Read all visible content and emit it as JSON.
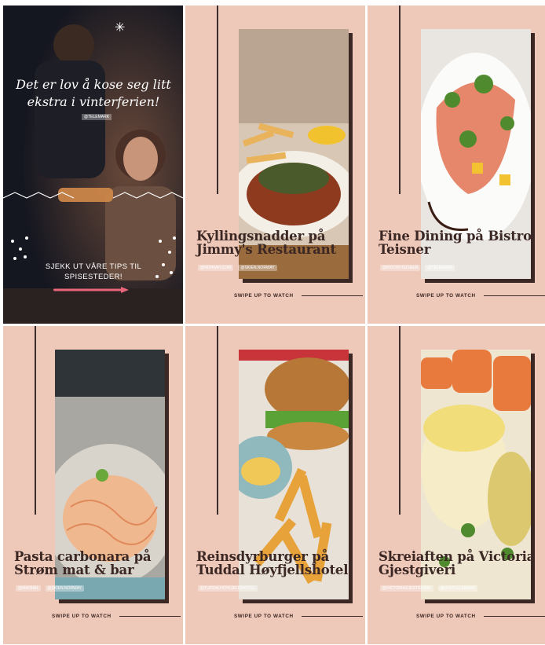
{
  "story_intro": {
    "heading": "Det er lov å kose seg litt ekstra i vinterferien!",
    "tag": "@TELEMARK",
    "cta": "SJEKK UT VÅRE TIPS TIL SPISESTEDER!"
  },
  "cards": [
    {
      "title": "Kyllingsnadder på Jimmy's Restaurant",
      "tags": [
        "@NORWAY.COM",
        "@SKIEN.NORWAY"
      ],
      "swipe": "SWIPE UP TO WATCH"
    },
    {
      "title": "Fine Dining på Bistro Teisner",
      "tags": [
        "@BISTROTEISNER",
        "@TELEMARK"
      ],
      "swipe": "SWIPE UP TO WATCH"
    },
    {
      "title": "Pasta carbonara på Strøm mat & bar",
      "tags": [
        "@MATBAR",
        "@SKIEN.NORWAY"
      ],
      "swipe": "SWIPE UP TO WATCH"
    },
    {
      "title": "Reinsdyrburger på Tuddal Høyfjellshotel",
      "tags": [
        "@TUDDALHOYFJELLSHOTEL"
      ],
      "swipe": "SWIPE UP TO WATCH"
    },
    {
      "title": "Skreiaften på Victoria Gjestgiveri",
      "tags": [
        "@VICTORIAGJESTGIVERI",
        "@VISITTELEMARK"
      ],
      "swipe": "SWIPE UP TO WATCH"
    }
  ],
  "colors": {
    "panel": "#eec8b8",
    "ink": "#3b2724",
    "story_bg": "#171a24",
    "accent": "#e8667a"
  },
  "icons": {
    "sparkle": "sparkle-icon",
    "arrow": "arrow-right-icon"
  }
}
